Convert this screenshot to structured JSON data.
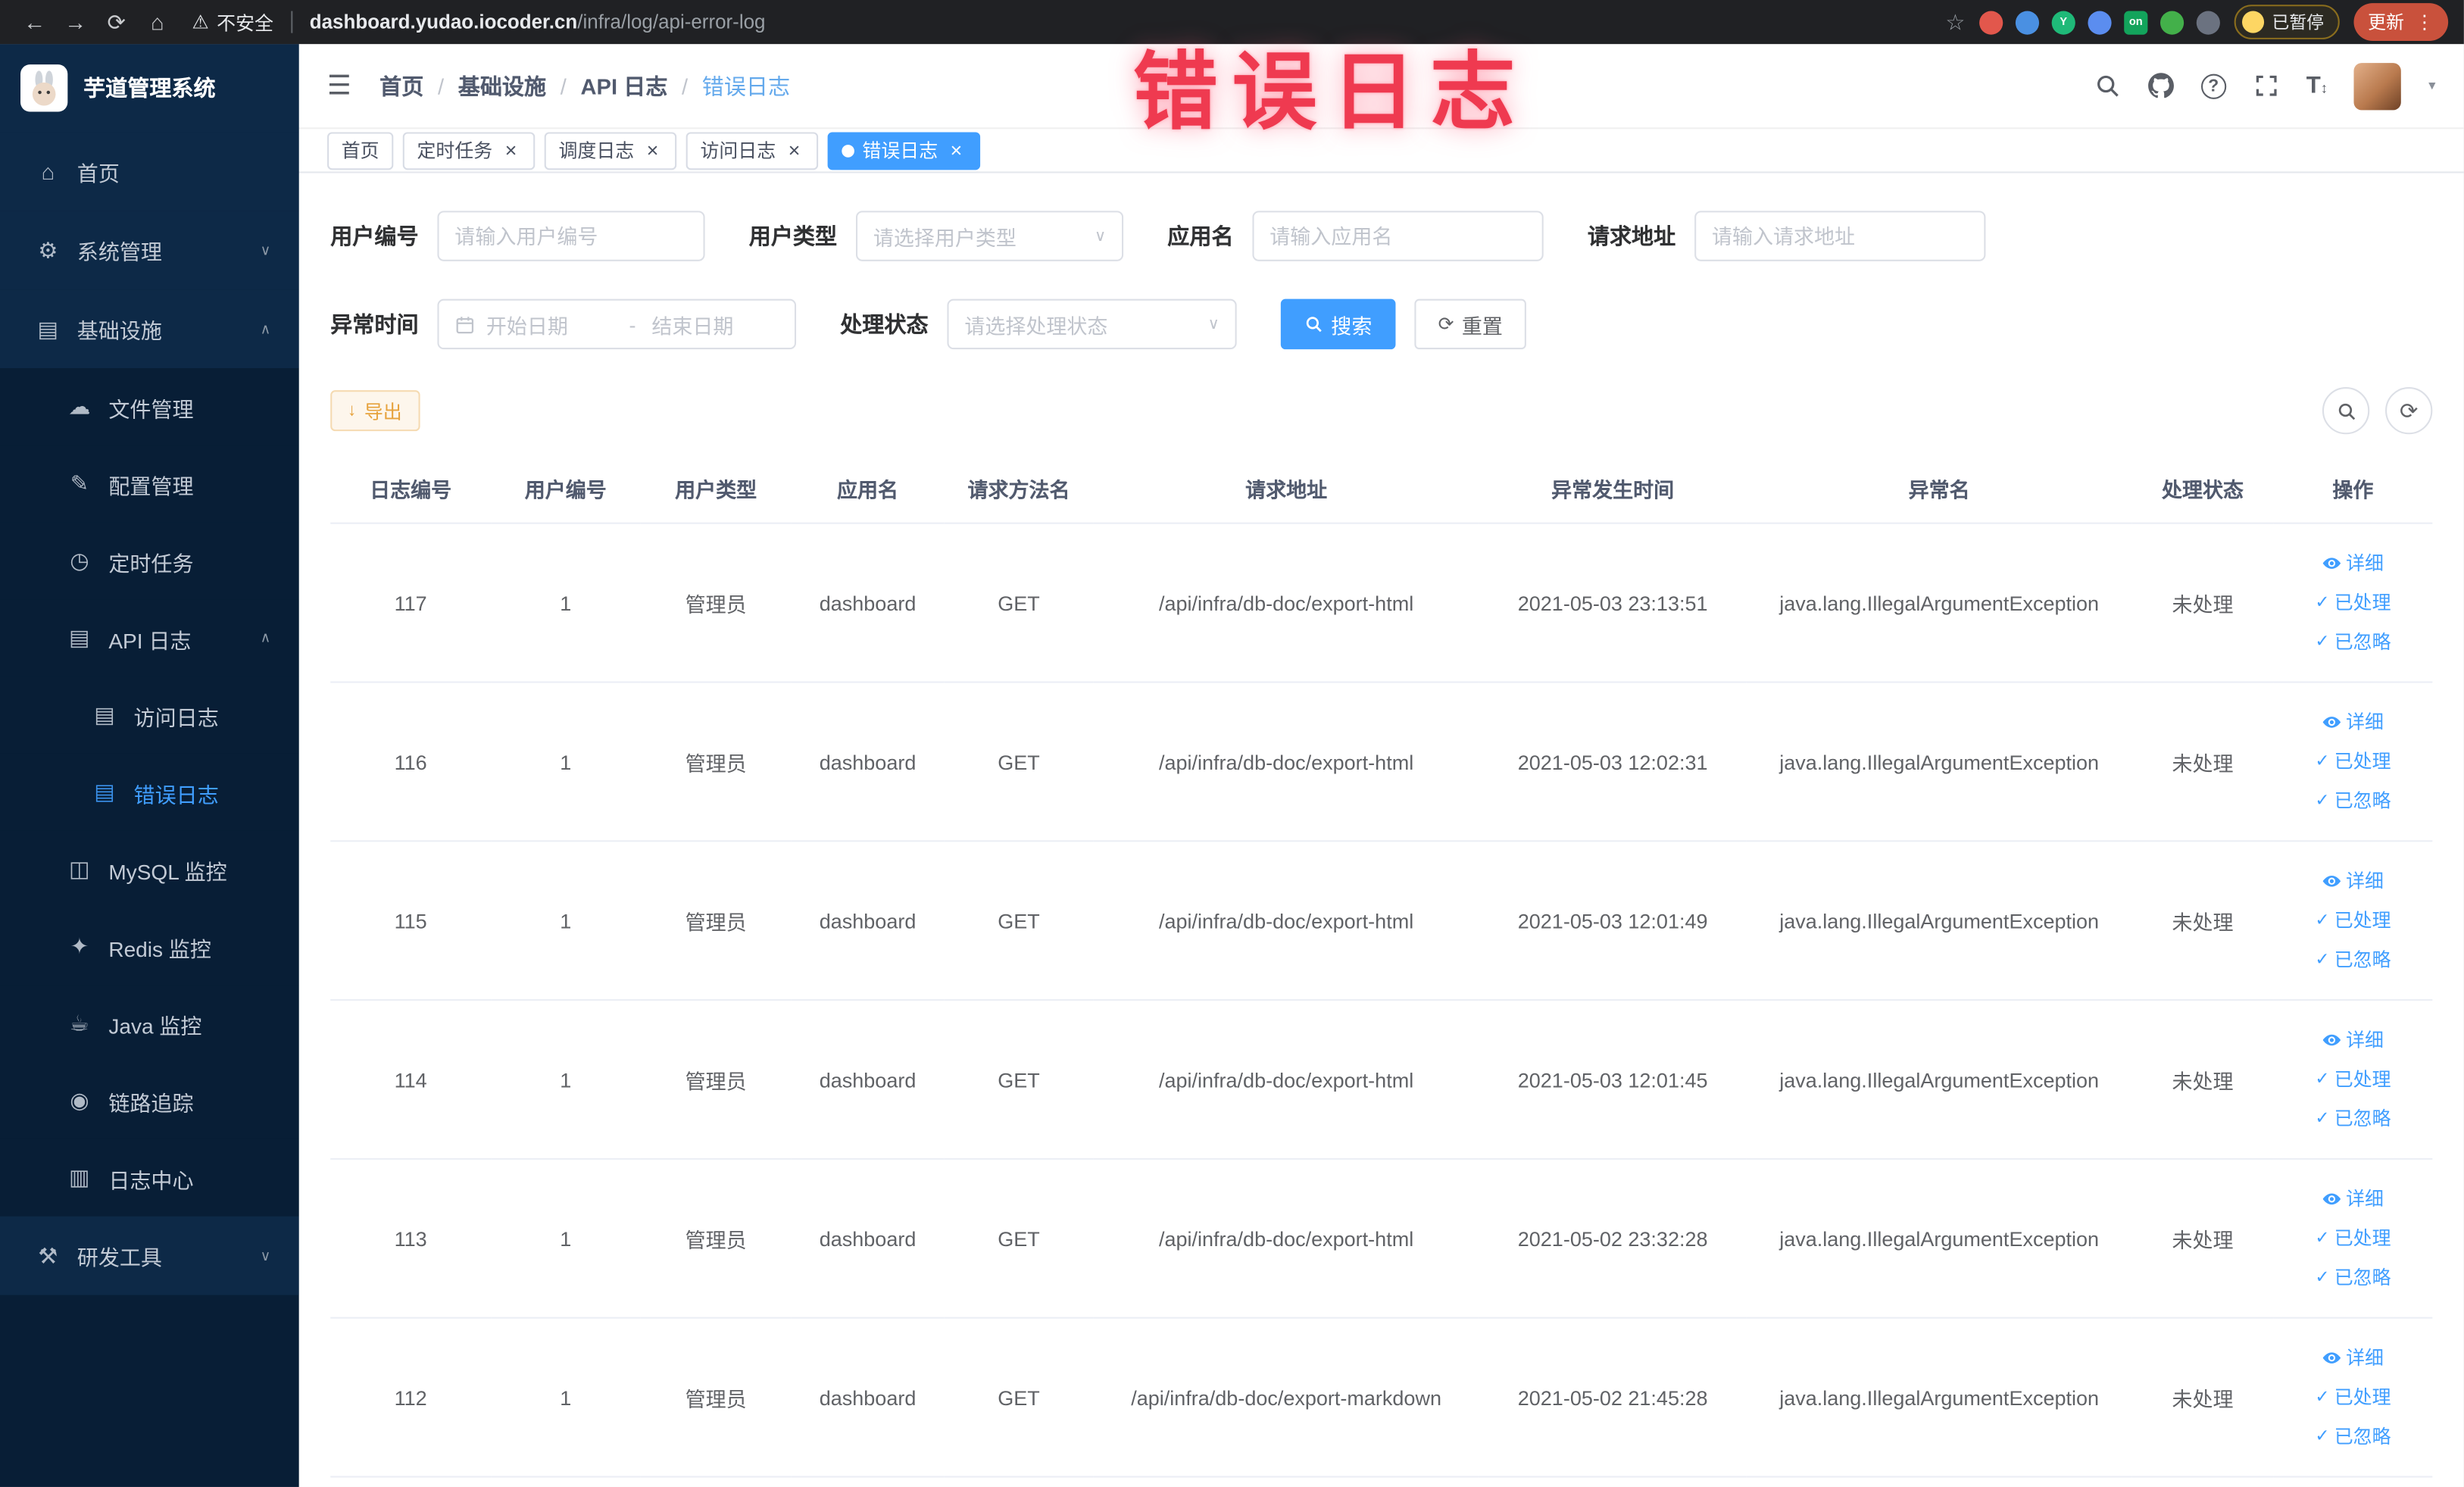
{
  "browser": {
    "security_warning": "不安全",
    "url_domain": "dashboard.yudao.iocoder.cn",
    "url_path": "/infra/log/api-error-log",
    "paused_badge": "已暂停",
    "update_button": "更新",
    "extensions": [
      {
        "name": "extension-red-icon",
        "color": "#e2574c",
        "text": ""
      },
      {
        "name": "extension-blue-drop-icon",
        "color": "#4a90e2",
        "text": ""
      },
      {
        "name": "extension-green-circle-icon",
        "color": "#1fb978",
        "text": "Y"
      },
      {
        "name": "extension-blue-grid-icon",
        "color": "#5b8def",
        "text": ""
      },
      {
        "name": "extension-on-badge-icon",
        "color": "#13a45c",
        "text": "on"
      },
      {
        "name": "extension-green-icon",
        "color": "#43b04a",
        "text": ""
      },
      {
        "name": "extension-pin-icon",
        "color": "#6b7280",
        "text": ""
      }
    ]
  },
  "annotation": {
    "text": "错误日志"
  },
  "sidebar": {
    "logo_title": "芋道管理系统",
    "items": [
      {
        "id": "home",
        "label": "首页",
        "icon": "home-icon",
        "level": 1
      },
      {
        "id": "system-mgmt",
        "label": "系统管理",
        "icon": "gear-icon",
        "level": 1,
        "expandable": true,
        "expanded": false
      },
      {
        "id": "infrastructure",
        "label": "基础设施",
        "icon": "monitor-icon",
        "level": 1,
        "expandable": true,
        "expanded": true
      },
      {
        "id": "file-mgmt",
        "label": "文件管理",
        "icon": "cloud-icon",
        "level": 2
      },
      {
        "id": "config-mgmt",
        "label": "配置管理",
        "icon": "edit-icon",
        "level": 2
      },
      {
        "id": "scheduled-jobs",
        "label": "定时任务",
        "icon": "clock-icon",
        "level": 2
      },
      {
        "id": "api-logs",
        "label": "API 日志",
        "icon": "log-icon",
        "level": 2,
        "expandable": true,
        "expanded": true
      },
      {
        "id": "access-log",
        "label": "访问日志",
        "icon": "doc-icon",
        "level": 3
      },
      {
        "id": "error-log",
        "label": "错误日志",
        "icon": "doc-icon",
        "level": 3,
        "active": true
      },
      {
        "id": "mysql-monitor",
        "label": "MySQL 监控",
        "icon": "database-icon",
        "level": 2
      },
      {
        "id": "redis-monitor",
        "label": "Redis 监控",
        "icon": "redis-icon",
        "level": 2
      },
      {
        "id": "java-monitor",
        "label": "Java 监控",
        "icon": "coffee-icon",
        "level": 2
      },
      {
        "id": "tracing",
        "label": "链路追踪",
        "icon": "eye-icon",
        "level": 2
      },
      {
        "id": "log-center",
        "label": "日志中心",
        "icon": "list-icon",
        "level": 2
      },
      {
        "id": "dev-tools",
        "label": "研发工具",
        "icon": "tools-icon",
        "level": 1,
        "expandable": true,
        "expanded": false
      }
    ]
  },
  "header": {
    "breadcrumbs": [
      "首页",
      "基础设施",
      "API 日志",
      "错误日志"
    ]
  },
  "tabs": [
    {
      "label": "首页",
      "active": false,
      "closable": false
    },
    {
      "label": "定时任务",
      "active": false,
      "closable": true
    },
    {
      "label": "调度日志",
      "active": false,
      "closable": true
    },
    {
      "label": "访问日志",
      "active": false,
      "closable": true
    },
    {
      "label": "错误日志",
      "active": true,
      "closable": true
    }
  ],
  "filters": {
    "user_id": {
      "label": "用户编号",
      "placeholder": "请输入用户编号"
    },
    "user_type": {
      "label": "用户类型",
      "placeholder": "请选择用户类型"
    },
    "app_name": {
      "label": "应用名",
      "placeholder": "请输入应用名"
    },
    "request_url": {
      "label": "请求地址",
      "placeholder": "请输入请求地址"
    },
    "exception_time": {
      "label": "异常时间",
      "start_placeholder": "开始日期",
      "separator": "-",
      "end_placeholder": "结束日期"
    },
    "process_status": {
      "label": "处理状态",
      "placeholder": "请选择处理状态"
    },
    "search_button": "搜索",
    "reset_button": "重置"
  },
  "toolbar": {
    "export_button": "导出"
  },
  "table": {
    "columns": [
      "日志编号",
      "用户编号",
      "用户类型",
      "应用名",
      "请求方法名",
      "请求地址",
      "异常发生时间",
      "异常名",
      "处理状态",
      "操作"
    ],
    "actions": {
      "detail": "详细",
      "processed": "已处理",
      "ignored": "已忽略"
    },
    "rows": [
      {
        "id": "117",
        "user_id": "1",
        "user_type": "管理员",
        "app": "dashboard",
        "method": "GET",
        "url": "/api/infra/db-doc/export-html",
        "time": "2021-05-03 23:13:51",
        "exception": "java.lang.IllegalArgumentException",
        "status": "未处理"
      },
      {
        "id": "116",
        "user_id": "1",
        "user_type": "管理员",
        "app": "dashboard",
        "method": "GET",
        "url": "/api/infra/db-doc/export-html",
        "time": "2021-05-03 12:02:31",
        "exception": "java.lang.IllegalArgumentException",
        "status": "未处理"
      },
      {
        "id": "115",
        "user_id": "1",
        "user_type": "管理员",
        "app": "dashboard",
        "method": "GET",
        "url": "/api/infra/db-doc/export-html",
        "time": "2021-05-03 12:01:49",
        "exception": "java.lang.IllegalArgumentException",
        "status": "未处理"
      },
      {
        "id": "114",
        "user_id": "1",
        "user_type": "管理员",
        "app": "dashboard",
        "method": "GET",
        "url": "/api/infra/db-doc/export-html",
        "time": "2021-05-03 12:01:45",
        "exception": "java.lang.IllegalArgumentException",
        "status": "未处理"
      },
      {
        "id": "113",
        "user_id": "1",
        "user_type": "管理员",
        "app": "dashboard",
        "method": "GET",
        "url": "/api/infra/db-doc/export-html",
        "time": "2021-05-02 23:32:28",
        "exception": "java.lang.IllegalArgumentException",
        "status": "未处理"
      },
      {
        "id": "112",
        "user_id": "1",
        "user_type": "管理员",
        "app": "dashboard",
        "method": "GET",
        "url": "/api/infra/db-doc/export-markdown",
        "time": "2021-05-02 21:45:28",
        "exception": "java.lang.IllegalArgumentException",
        "status": "未处理"
      }
    ]
  },
  "colors": {
    "accent": "#409eff",
    "warning": "#e6a23c",
    "annotation_red": "#ef3a50",
    "sidebar_bg": "#081e36"
  }
}
